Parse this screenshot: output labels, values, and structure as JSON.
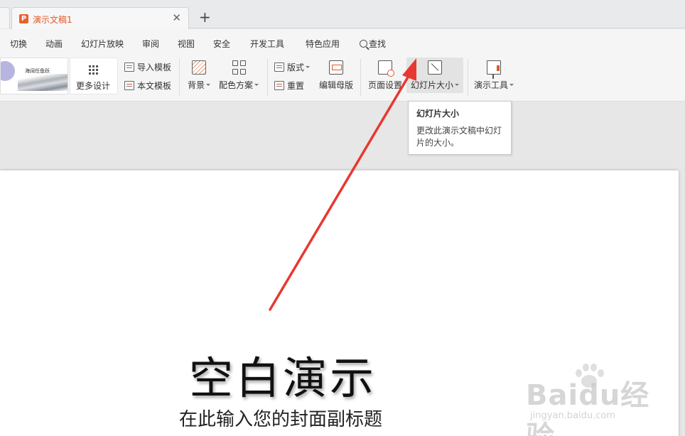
{
  "tabs": {
    "doc_tab_title": "演示文稿1",
    "ppt_icon_letter": "P",
    "close_glyph": "✕",
    "new_tab_glyph": "+"
  },
  "menu": {
    "items": [
      "切换",
      "动画",
      "幻灯片放映",
      "审阅",
      "视图",
      "安全",
      "开发工具",
      "特色应用"
    ],
    "search_label": "查找"
  },
  "ribbon": {
    "thumb_text": "海阔任鱼跃",
    "more_design": "更多设计",
    "import_template": "导入模板",
    "this_template": "本文模板",
    "background": "背景",
    "color_scheme": "配色方案",
    "layout": "版式",
    "reset": "重置",
    "edit_master": "编辑母版",
    "page_setup": "页面设置",
    "slide_size": "幻灯片大小",
    "presentation_tools": "演示工具"
  },
  "tooltip": {
    "title": "幻灯片大小",
    "description": "更改此演示文稿中幻灯片的大小。"
  },
  "slide": {
    "title": "空白演示",
    "subtitle": "在此输入您的封面副标题"
  },
  "watermark": {
    "logo": "Baidu经验",
    "url": "jingyan.baidu.com"
  },
  "colors": {
    "accent": "#e0582a",
    "annotation_arrow": "#e8382f"
  }
}
